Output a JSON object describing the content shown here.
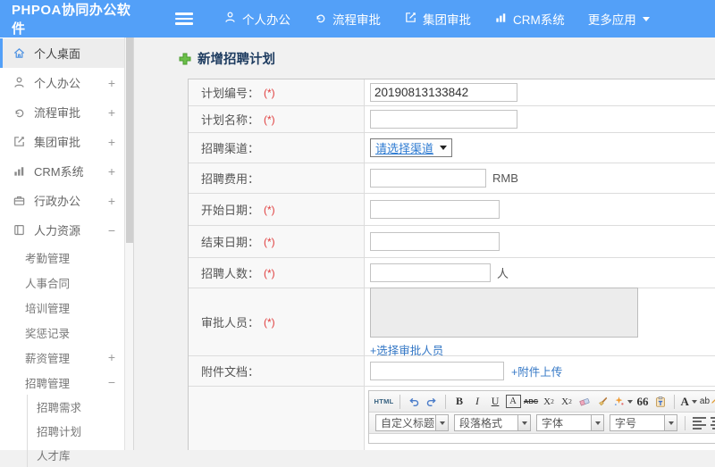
{
  "topbar": {
    "logo": "PHPOA协同办公软件",
    "nav": [
      {
        "label": "个人办公"
      },
      {
        "label": "流程审批"
      },
      {
        "label": "集团审批"
      },
      {
        "label": "CRM系统"
      },
      {
        "label": "更多应用"
      }
    ]
  },
  "sidebar": {
    "items": [
      {
        "label": "个人桌面"
      },
      {
        "label": "个人办公",
        "toggle": "+"
      },
      {
        "label": "流程审批",
        "toggle": "+"
      },
      {
        "label": "集团审批",
        "toggle": "+"
      },
      {
        "label": "CRM系统",
        "toggle": "+"
      },
      {
        "label": "行政办公",
        "toggle": "+"
      },
      {
        "label": "人力资源",
        "toggle": "−"
      }
    ],
    "hr_children": [
      {
        "label": "考勤管理"
      },
      {
        "label": "人事合同"
      },
      {
        "label": "培训管理"
      },
      {
        "label": "奖惩记录"
      },
      {
        "label": "薪资管理",
        "toggle": "+"
      },
      {
        "label": "招聘管理",
        "toggle": "−"
      }
    ],
    "recruit_children": [
      {
        "label": "招聘需求"
      },
      {
        "label": "招聘计划"
      },
      {
        "label": "人才库"
      }
    ]
  },
  "main": {
    "title": "新增招聘计划",
    "form": {
      "plan_no": {
        "label": "计划编号：",
        "required": "(*)",
        "value": "20190813133842"
      },
      "plan_name": {
        "label": "计划名称：",
        "required": "(*)"
      },
      "channel": {
        "label": "招聘渠道：",
        "select_value": "请选择渠道"
      },
      "fee": {
        "label": "招聘费用：",
        "suffix": "RMB"
      },
      "start_date": {
        "label": "开始日期：",
        "required": "(*)"
      },
      "end_date": {
        "label": "结束日期：",
        "required": "(*)"
      },
      "headcount": {
        "label": "招聘人数：",
        "required": "(*)",
        "suffix": "人"
      },
      "approver": {
        "label": "审批人员：",
        "required": "(*)",
        "link": "+选择审批人员"
      },
      "attachment": {
        "label": "附件文档：",
        "link": "+附件上传"
      }
    },
    "editor": {
      "html_button": "HTML",
      "bold": "B",
      "italic": "I",
      "underline": "U",
      "font_box": "A",
      "strike": "ABC",
      "sup_base": "X",
      "sup_exp": "2",
      "sub_base": "X",
      "sub_exp": "2",
      "quote": "66",
      "font_color": "A",
      "bg_color": "ab",
      "dropdowns": [
        {
          "label": "自定义标题"
        },
        {
          "label": "段落格式"
        },
        {
          "label": "字体"
        },
        {
          "label": "字号"
        }
      ]
    },
    "colors": {
      "accent_blue": "#53a0f8",
      "link_blue": "#3578c6",
      "required_red": "#e03e3e",
      "title_navy": "#1e3c60",
      "plus_green": "#5cb232"
    }
  }
}
